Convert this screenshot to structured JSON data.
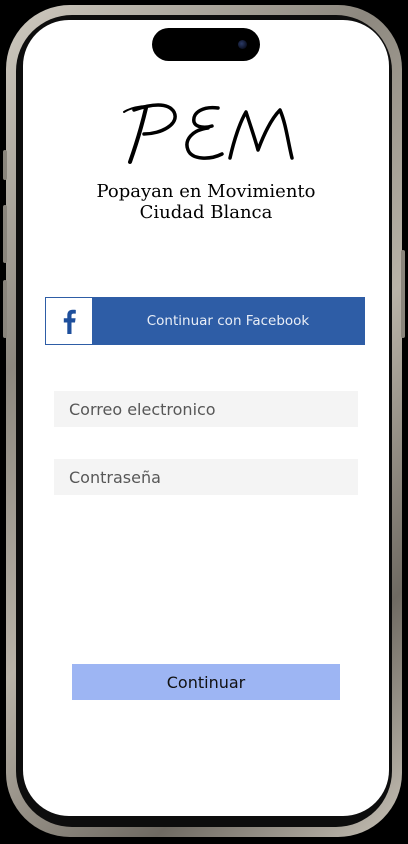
{
  "logo": {
    "mark": "PEM",
    "tagline_line1": "Popayan en Movimiento",
    "tagline_line2": "Ciudad Blanca"
  },
  "facebook_button": {
    "label": "Continuar con Facebook",
    "icon": "facebook-icon",
    "color": "#2e5da6"
  },
  "email_input": {
    "value": "",
    "placeholder": "Correo electronico"
  },
  "password_input": {
    "value": "",
    "placeholder": "Contraseña"
  },
  "continue_button": {
    "label": "Continuar",
    "color": "#9db5f3"
  }
}
